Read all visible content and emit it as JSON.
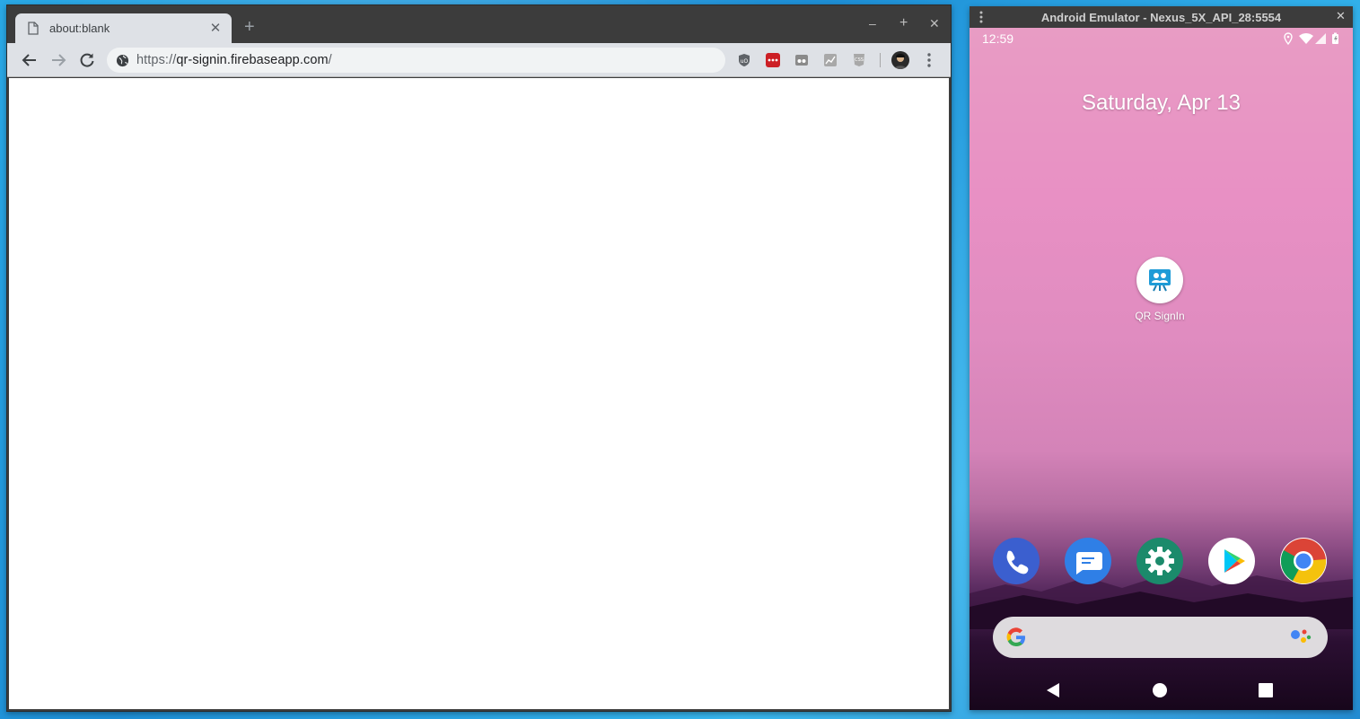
{
  "browser": {
    "tab_title": "about:blank",
    "tab_close": "✕",
    "new_tab": "+",
    "window_controls": {
      "minimize": "–",
      "maximize": "+",
      "close": "✕"
    },
    "url_scheme": "https://",
    "url_host": "qr-signin.firebaseapp.com",
    "url_path": "/",
    "icons": [
      "back-icon",
      "forward-icon",
      "reload-icon",
      "globe-icon",
      "ublock-icon",
      "lastpass-icon",
      "extension-icon",
      "chart-extension-icon",
      "css-extension-icon",
      "avatar",
      "menu-icon"
    ],
    "colors": {
      "frame": "#3c3c3c",
      "toolbar": "#dee1e6",
      "omnibox": "#f1f3f4"
    }
  },
  "emulator": {
    "window_title": "Android Emulator - Nexus_5X_API_28:5554",
    "close_label": "✕",
    "status_time": "12:59",
    "date": "Saturday, Apr 13",
    "app_label": "QR SignIn",
    "dock": [
      "phone-icon",
      "messages-icon",
      "settings-icon",
      "play-store-icon",
      "chrome-icon"
    ],
    "nav": [
      "back-nav-icon",
      "home-nav-icon",
      "recents-nav-icon"
    ]
  }
}
